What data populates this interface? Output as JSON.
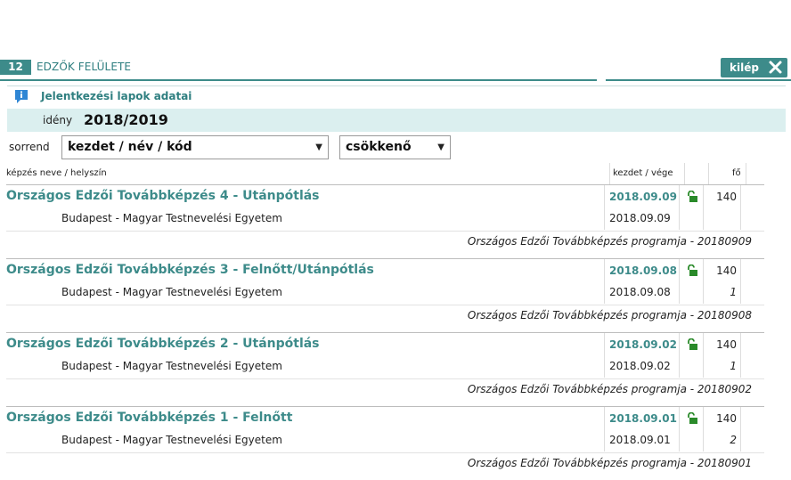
{
  "header": {
    "number": "12",
    "title": "EDZŐK FELÜLETE",
    "exit_label": "kilép",
    "accent": "#3d8b8a"
  },
  "section": {
    "title": "Jelentkezési lapok adatai"
  },
  "season": {
    "label": "idény",
    "value": "2018/2019"
  },
  "sort": {
    "label": "sorrend",
    "field_value": "kezdet / név / kód",
    "order_value": "csökkenő"
  },
  "columns": {
    "name_place": "képzés neve / helyszín",
    "start_end": "kezdet / vége",
    "count": "fő"
  },
  "entries": [
    {
      "name": "Országos Edzői Továbbképzés 4 - Utánpótlás",
      "place": "Budapest - Magyar Testnevelési Egyetem",
      "start": "2018.09.09",
      "end": "2018.09.09",
      "count": "140",
      "sub": "",
      "program": "Országos Edzői Továbbképzés programja - 20180909"
    },
    {
      "name": "Országos Edzői Továbbképzés 3 - Felnőtt/Utánpótlás",
      "place": "Budapest - Magyar Testnevelési Egyetem",
      "start": "2018.09.08",
      "end": "2018.09.08",
      "count": "140",
      "sub": "1",
      "program": "Országos Edzői Továbbképzés programja - 20180908"
    },
    {
      "name": "Országos Edzői Továbbképzés 2 - Utánpótlás",
      "place": "Budapest - Magyar Testnevelési Egyetem",
      "start": "2018.09.02",
      "end": "2018.09.02",
      "count": "140",
      "sub": "1",
      "program": "Országos Edzői Továbbképzés programja - 20180902"
    },
    {
      "name": "Országos Edzői Továbbképzés 1 - Felnőtt",
      "place": "Budapest - Magyar Testnevelési Egyetem",
      "start": "2018.09.01",
      "end": "2018.09.01",
      "count": "140",
      "sub": "2",
      "program": "Országos Edzői Továbbképzés programja - 20180901"
    }
  ]
}
